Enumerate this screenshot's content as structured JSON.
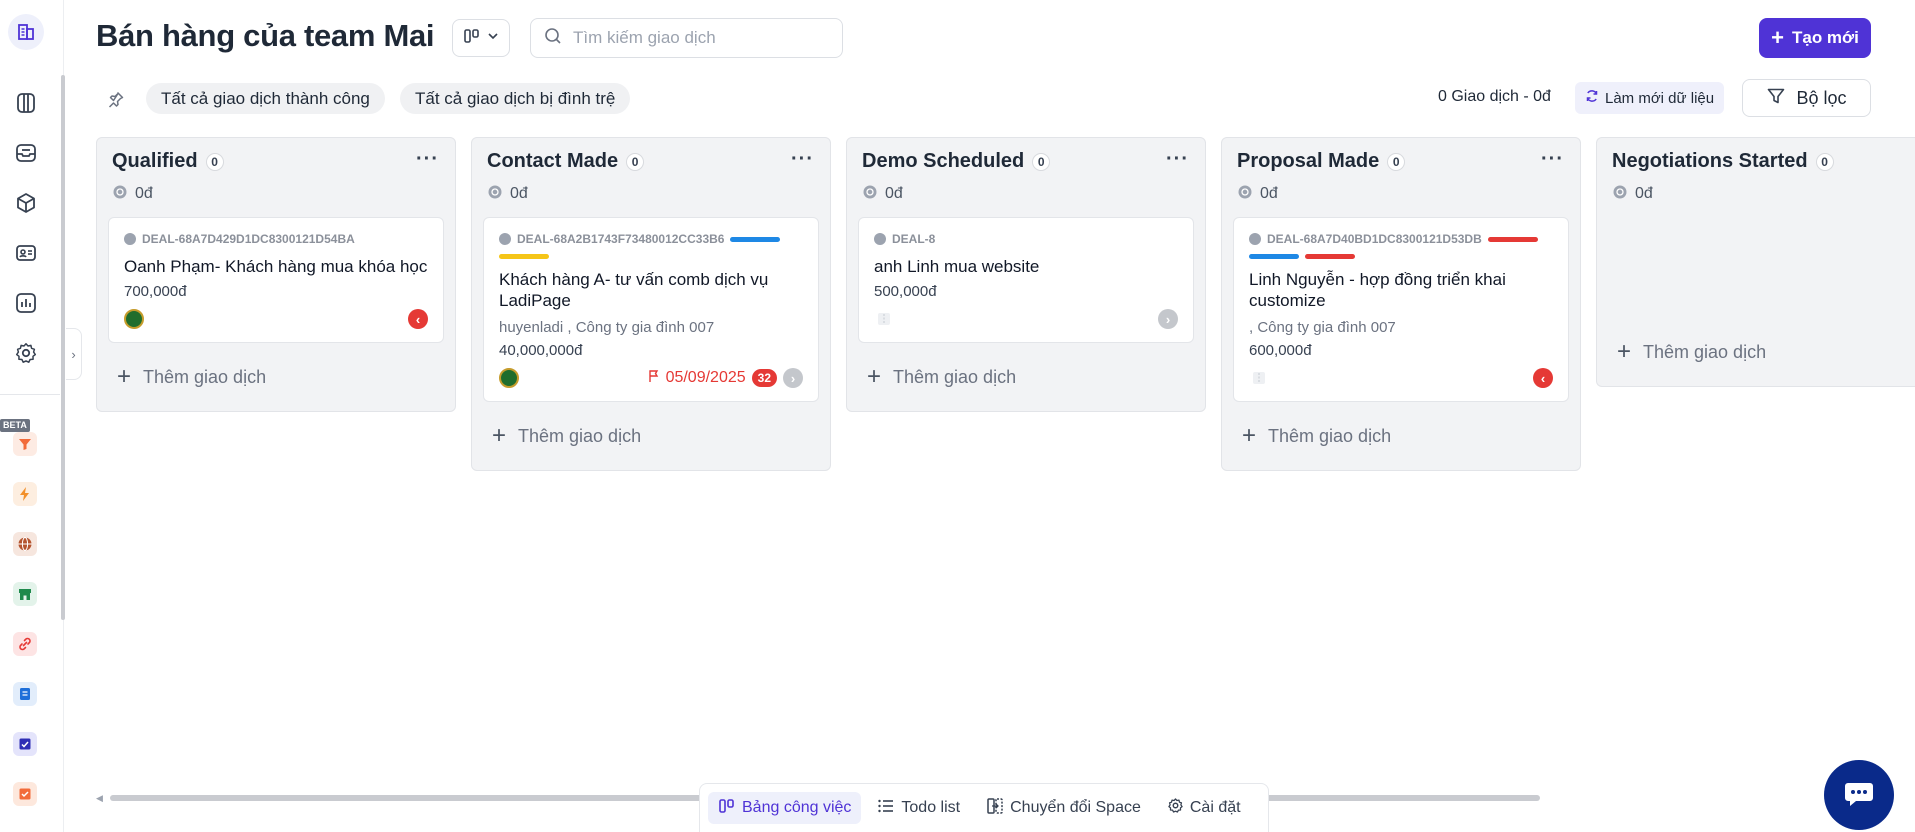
{
  "header": {
    "title": "Bán hàng của team Mai",
    "search_placeholder": "Tìm kiếm giao dịch",
    "create_label": "Tạo mới"
  },
  "filters": {
    "chips": [
      "Tất cả giao dịch thành công",
      "Tất cả giao dịch bị đình trệ"
    ],
    "summary": "0 Giao dịch - 0đ",
    "refresh_label": "Làm mới dữ liệu",
    "filter_label": "Bộ lọc"
  },
  "sidebar": {
    "beta_label": "BETA",
    "nav_icons": [
      "dashboard-icon",
      "inbox-icon",
      "products-icon",
      "contacts-icon",
      "reports-icon",
      "settings-icon"
    ],
    "app_icons": [
      "funnel-app-icon",
      "automation-app-icon",
      "website-app-icon",
      "store-app-icon",
      "link-app-icon",
      "document-app-icon",
      "form-app-icon",
      "survey-app-icon"
    ]
  },
  "columns": [
    {
      "name": "Qualified",
      "count": "0",
      "amount": "0đ",
      "add_label": "Thêm giao dịch",
      "cards": [
        {
          "id": "DEAL-68A7D429D1DC8300121D54BA",
          "title": "Oanh Phạm- Khách hàng mua khóa học",
          "sub": "",
          "value": "700,000đ",
          "due": "",
          "due_count": "",
          "action": "red"
        }
      ]
    },
    {
      "name": "Contact Made",
      "count": "0",
      "amount": "0đ",
      "add_label": "Thêm giao dịch",
      "cards": [
        {
          "id": "DEAL-68A2B1743F73480012CC33B6",
          "title": "Khách hàng A- tư vấn comb dịch vụ LadiPage",
          "sub": "huyenladi , Công ty gia đình 007",
          "value": "40,000,000đ",
          "due": "05/09/2025",
          "due_count": "32",
          "action": "gray"
        }
      ]
    },
    {
      "name": "Demo Scheduled",
      "count": "0",
      "amount": "0đ",
      "add_label": "Thêm giao dịch",
      "cards": [
        {
          "id": "DEAL-8",
          "title": "anh Linh mua website",
          "sub": "",
          "value": "500,000đ",
          "due": "",
          "due_count": "",
          "action": "gray"
        }
      ]
    },
    {
      "name": "Proposal Made",
      "count": "0",
      "amount": "0đ",
      "add_label": "Thêm giao dịch",
      "cards": [
        {
          "id": "DEAL-68A7D40BD1DC8300121D53DB",
          "title": "Linh Nguyễn - hợp đồng triển khai customize",
          "sub": ", Công ty gia đình 007",
          "value": "600,000đ",
          "due": "",
          "due_count": "",
          "action": "red"
        }
      ]
    },
    {
      "name": "Negotiations Started",
      "count": "0",
      "amount": "0đ",
      "add_label": "Thêm giao dịch",
      "cards": []
    }
  ],
  "bottom_bar": {
    "items": [
      "Bảng công việc",
      "Todo list",
      "Chuyển đổi Space",
      "Cài đặt"
    ]
  },
  "colors": {
    "accent": "#4f33d6",
    "danger": "#e53935",
    "tag_blue": "#1e88e5",
    "tag_yellow": "#f5c518",
    "tag_red": "#e53935",
    "chat": "#0a2a8a"
  }
}
